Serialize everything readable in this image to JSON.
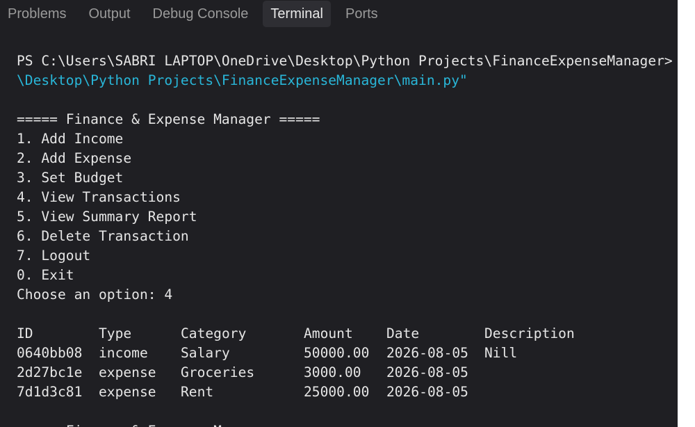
{
  "tabs": [
    {
      "label": "Problems",
      "active": false
    },
    {
      "label": "Output",
      "active": false
    },
    {
      "label": "Debug Console",
      "active": false
    },
    {
      "label": "Terminal",
      "active": true
    },
    {
      "label": "Ports",
      "active": false
    }
  ],
  "terminal": {
    "prompt_line": "PS C:\\Users\\SABRI LAPTOP\\OneDrive\\Desktop\\Python Projects\\FinanceExpenseManager> & ",
    "command_continuation": "\\Desktop\\Python Projects\\FinanceExpenseManager\\main.py\"",
    "menu_title": "===== Finance & Expense Manager =====",
    "menu_items": [
      "1. Add Income",
      "2. Add Expense",
      "3. Set Budget",
      "4. View Transactions",
      "5. View Summary Report",
      "6. Delete Transaction",
      "7. Logout",
      "0. Exit"
    ],
    "choice_prompt": "Choose an option: 4",
    "table": {
      "headers": [
        "ID",
        "Type",
        "Category",
        "Amount",
        "Date",
        "Description"
      ],
      "rows": [
        [
          "0640bb08",
          "income",
          "Salary",
          "50000.00",
          "2026-08-05",
          "Nill"
        ],
        [
          "2d27bc1e",
          "expense",
          "Groceries",
          "3000.00",
          "2026-08-05",
          ""
        ],
        [
          "7d1d3c81",
          "expense",
          "Rent",
          "25000.00",
          "2026-08-05",
          ""
        ]
      ]
    },
    "partial_next_line": "===== Finance & Expense Manager ====="
  },
  "colors": {
    "background": "#1f1f23",
    "text": "#e6e6e6",
    "path_cyan": "#29b6d8",
    "tab_inactive": "#9a9a9a",
    "tab_active_bg": "#2e2e33"
  }
}
